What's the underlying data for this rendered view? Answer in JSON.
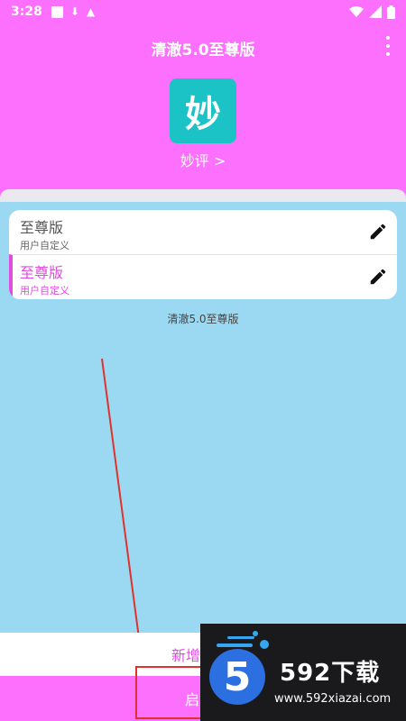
{
  "status": {
    "time": "3:28"
  },
  "header": {
    "title": "清澈5.0至尊版"
  },
  "app": {
    "icon_glyph": "妙",
    "name": "妙评 >"
  },
  "configs": [
    {
      "name": "至尊版",
      "sub": "用户自定义"
    },
    {
      "name": "至尊版",
      "sub": "用户自定义"
    }
  ],
  "caption": "清澈5.0至尊版",
  "add_label": "新增",
  "start_label": "启",
  "watermark": {
    "digit": "5",
    "brand": "592下载",
    "url": "www.592xiazai.com"
  },
  "colors": {
    "header": "#fd6ffd",
    "accent": "#e24be2",
    "background": "#9bd9f2",
    "app_icon": "#1cc3c6",
    "annotation": "#e0322d"
  }
}
